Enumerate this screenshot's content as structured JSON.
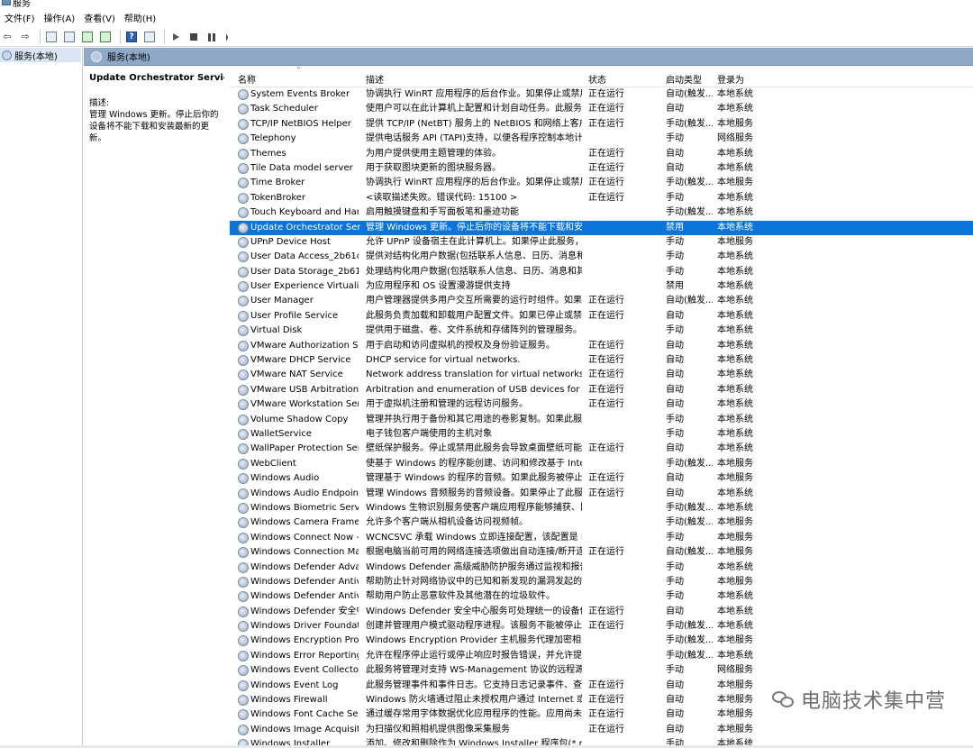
{
  "window": {
    "title": "服务"
  },
  "menu": [
    {
      "label": "文件(F)"
    },
    {
      "label": "操作(A)"
    },
    {
      "label": "查看(V)"
    },
    {
      "label": "帮助(H)"
    }
  ],
  "toolbar": {
    "buttons": [
      {
        "name": "back-icon"
      },
      {
        "name": "forward-icon"
      },
      {
        "name": "show-tree-icon"
      },
      {
        "name": "properties-icon"
      },
      {
        "name": "refresh-icon"
      },
      {
        "name": "export-icon"
      },
      {
        "name": "help-icon"
      },
      {
        "name": "view-icon"
      },
      {
        "name": "start-service-icon"
      },
      {
        "name": "stop-service-icon"
      },
      {
        "name": "pause-service-icon"
      },
      {
        "name": "restart-service-icon"
      }
    ]
  },
  "tree": {
    "root_label": "服务(本地)"
  },
  "pane": {
    "header_title": "服务(本地)"
  },
  "description": {
    "service_title": "Update Orchestrator Service",
    "label": "描述:",
    "text": "管理 Windows 更新。停止后你的设备将不能下载和安装最新的更新。"
  },
  "columns": {
    "name": "名称",
    "desc": "描述",
    "status": "状态",
    "start": "启动类型",
    "logon": "登录为"
  },
  "rows": [
    {
      "name": "System Events Broker",
      "desc": "协调执行 WinRT 应用程序的后台作业。如果停止或禁用...",
      "status": "正在运行",
      "start": "自动(触发...",
      "logon": "本地系统"
    },
    {
      "name": "Task Scheduler",
      "desc": "使用户可以在此计算机上配置和计划自动任务。此服务...",
      "status": "正在运行",
      "start": "自动",
      "logon": "本地系统"
    },
    {
      "name": "TCP/IP NetBIOS Helper",
      "desc": "提供 TCP/IP (NetBT) 服务上的 NetBIOS 和网络上客户...",
      "status": "正在运行",
      "start": "手动(触发...",
      "logon": "本地服务"
    },
    {
      "name": "Telephony",
      "desc": "提供电话服务 API (TAPI)支持，以便各程序控制本地计...",
      "status": "",
      "start": "手动",
      "logon": "网络服务"
    },
    {
      "name": "Themes",
      "desc": "为用户提供使用主题管理的体验。",
      "status": "正在运行",
      "start": "自动",
      "logon": "本地系统"
    },
    {
      "name": "Tile Data model server",
      "desc": "用于获取图块更新的图块服务器。",
      "status": "正在运行",
      "start": "自动",
      "logon": "本地系统"
    },
    {
      "name": "Time Broker",
      "desc": "协调执行 WinRT 应用程序的后台作业。如果停止或禁用...",
      "status": "正在运行",
      "start": "手动(触发...",
      "logon": "本地服务"
    },
    {
      "name": "TokenBroker",
      "desc": "<读取描述失败。错误代码: 15100 >",
      "status": "正在运行",
      "start": "手动",
      "logon": "本地系统"
    },
    {
      "name": "Touch Keyboard and Hand...",
      "desc": "启用触摸键盘和手写面板笔和墨迹功能",
      "status": "",
      "start": "手动(触发...",
      "logon": "本地系统"
    },
    {
      "name": "Update Orchestrator Service",
      "desc": "管理 Windows 更新。停止后你的设备将不能下载和安...",
      "status": "",
      "start": "禁用",
      "logon": "本地系统",
      "selected": true
    },
    {
      "name": "UPnP Device Host",
      "desc": "允许 UPnP 设备宿主在此计算机上。如果停止此服务，...",
      "status": "",
      "start": "手动",
      "logon": "本地服务"
    },
    {
      "name": "User Data Access_2b61d305",
      "desc": "提供对结构化用户数据(包括联系人信息、日历、消息和...",
      "status": "",
      "start": "手动",
      "logon": "本地系统"
    },
    {
      "name": "User Data Storage_2b61d3...",
      "desc": "处理结构化用户数据(包括联系人信息、日历、消息和其...",
      "status": "",
      "start": "手动",
      "logon": "本地系统"
    },
    {
      "name": "User Experience Virtualizat...",
      "desc": "为应用程序和 OS 设置漫游提供支持",
      "status": "",
      "start": "禁用",
      "logon": "本地系统"
    },
    {
      "name": "User Manager",
      "desc": "用户管理器提供多用户交互所需要的运行时组件。如果...",
      "status": "正在运行",
      "start": "自动(触发...",
      "logon": "本地系统"
    },
    {
      "name": "User Profile Service",
      "desc": "此服务负责加载和卸载用户配置文件。如果已停止或禁...",
      "status": "正在运行",
      "start": "自动",
      "logon": "本地系统"
    },
    {
      "name": "Virtual Disk",
      "desc": "提供用于磁盘、卷、文件系统和存储阵列的管理服务。",
      "status": "",
      "start": "手动",
      "logon": "本地系统"
    },
    {
      "name": "VMware Authorization Ser...",
      "desc": "用于启动和访问虚拟机的授权及身份验证服务。",
      "status": "正在运行",
      "start": "自动",
      "logon": "本地系统"
    },
    {
      "name": "VMware DHCP Service",
      "desc": "DHCP service for virtual networks.",
      "status": "正在运行",
      "start": "自动",
      "logon": "本地系统"
    },
    {
      "name": "VMware NAT Service",
      "desc": "Network address translation for virtual networks.",
      "status": "正在运行",
      "start": "自动",
      "logon": "本地系统"
    },
    {
      "name": "VMware USB Arbitration S...",
      "desc": "Arbitration and enumeration of USB devices for virtual ...",
      "status": "正在运行",
      "start": "自动",
      "logon": "本地系统"
    },
    {
      "name": "VMware Workstation Server",
      "desc": "用于虚拟机注册和管理的远程访问服务。",
      "status": "正在运行",
      "start": "自动",
      "logon": "本地系统"
    },
    {
      "name": "Volume Shadow Copy",
      "desc": "管理并执行用于备份和其它用途的卷影复制。如果此服...",
      "status": "",
      "start": "手动",
      "logon": "本地系统"
    },
    {
      "name": "WalletService",
      "desc": "电子钱包客户端使用的主机对象",
      "status": "",
      "start": "手动",
      "logon": "本地系统"
    },
    {
      "name": "WallPaper Protection Servi...",
      "desc": "壁纸保护服务。停止或禁用此服务会导致桌面壁纸可能...",
      "status": "正在运行",
      "start": "自动",
      "logon": "本地系统"
    },
    {
      "name": "WebClient",
      "desc": "使基于 Windows 的程序能创建、访问和修改基于 Intern...",
      "status": "",
      "start": "手动(触发...",
      "logon": "本地服务"
    },
    {
      "name": "Windows Audio",
      "desc": "管理基于 Windows 的程序的音频。如果此服务被停止...",
      "status": "正在运行",
      "start": "自动",
      "logon": "本地服务"
    },
    {
      "name": "Windows Audio Endpoint B...",
      "desc": "管理 Windows 音频服务的音频设备。如果停止了此服...",
      "status": "正在运行",
      "start": "自动",
      "logon": "本地系统"
    },
    {
      "name": "Windows Biometric Service",
      "desc": "Windows 生物识别服务使客户端应用程序能够捕获、比...",
      "status": "",
      "start": "手动(触发...",
      "logon": "本地系统"
    },
    {
      "name": "Windows Camera Frame S...",
      "desc": "允许多个客户端从相机设备访问视频帧。",
      "status": "",
      "start": "手动(触发...",
      "logon": "本地服务"
    },
    {
      "name": "Windows Connect Now - C...",
      "desc": "WCNCSVC 承载 Windows 立即连接配置，该配置是 Mi...",
      "status": "",
      "start": "手动",
      "logon": "本地服务"
    },
    {
      "name": "Windows Connection Man...",
      "desc": "根据电脑当前可用的网络连接选项做出自动连接/断开连...",
      "status": "正在运行",
      "start": "自动(触发...",
      "logon": "本地服务"
    },
    {
      "name": "Windows Defender Advan...",
      "desc": "Windows Defender 高级威胁防护服务通过监视和报告...",
      "status": "",
      "start": "手动",
      "logon": "本地系统"
    },
    {
      "name": "Windows Defender Antivir...",
      "desc": "帮助防止针对网络协议中的已知和新发现的漏洞发起的...",
      "status": "",
      "start": "手动",
      "logon": "本地服务"
    },
    {
      "name": "Windows Defender Antivir...",
      "desc": "帮助用户防止恶意软件及其他潜在的垃圾软件。",
      "status": "",
      "start": "手动",
      "logon": "本地系统"
    },
    {
      "name": "Windows Defender 安全中...",
      "desc": "Windows Defender 安全中心服务可处理统一的设备保...",
      "status": "正在运行",
      "start": "自动",
      "logon": "本地系统"
    },
    {
      "name": "Windows Driver Foundatio...",
      "desc": "创建并管理用户模式驱动程序进程。该服务不能被停止。",
      "status": "正在运行",
      "start": "手动(触发...",
      "logon": "本地系统"
    },
    {
      "name": "Windows Encryption Provid...",
      "desc": "Windows Encryption Provider 主机服务代理加密相关功...",
      "status": "",
      "start": "手动(触发...",
      "logon": "本地服务"
    },
    {
      "name": "Windows Error Reporting S...",
      "desc": "允许在程序停止运行或停止响应时报告错误，并允许提...",
      "status": "",
      "start": "手动(触发...",
      "logon": "本地系统"
    },
    {
      "name": "Windows Event Collector",
      "desc": "此服务将管理对支持 WS-Management 协议的远程源中...",
      "status": "",
      "start": "手动",
      "logon": "网络服务"
    },
    {
      "name": "Windows Event Log",
      "desc": "此服务管理事件和事件日志。它支持日志记录事件、查...",
      "status": "正在运行",
      "start": "自动",
      "logon": "本地服务"
    },
    {
      "name": "Windows Firewall",
      "desc": "Windows 防火墙通过阻止未授权用户通过 Internet 或网...",
      "status": "正在运行",
      "start": "自动",
      "logon": "本地服务"
    },
    {
      "name": "Windows Font Cache Servi...",
      "desc": "通过缓存常用字体数据优化应用程序的性能。应用尚未...",
      "status": "正在运行",
      "start": "自动",
      "logon": "本地服务"
    },
    {
      "name": "Windows Image Acquisitio...",
      "desc": "为扫描仪和照相机提供图像采集服务",
      "status": "正在运行",
      "start": "自动",
      "logon": "本地服务"
    },
    {
      "name": "Windows Installer",
      "desc": "添加、修改和删除作为 Windows Installer 程序包(*.msi...",
      "status": "",
      "start": "手动",
      "logon": "本地系统"
    }
  ],
  "watermark": {
    "text": "电脑技术集中营"
  }
}
